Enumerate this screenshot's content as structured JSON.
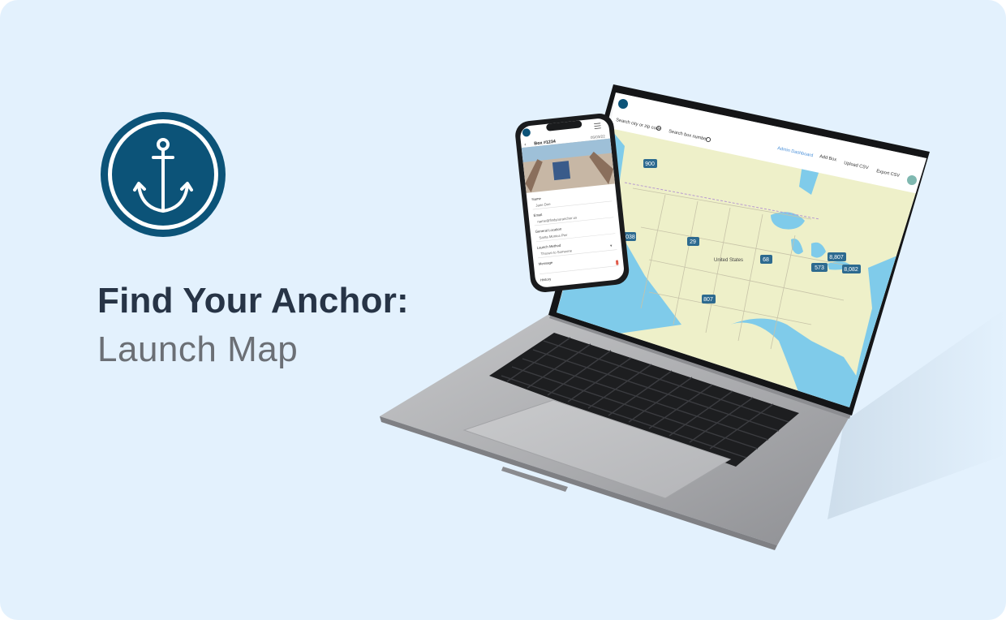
{
  "hero": {
    "title": "Find Your Anchor:",
    "subtitle": "Launch Map",
    "logo_icon": "anchor-icon",
    "brand_color": "#0c5378",
    "background": "#e3f1fd"
  },
  "laptop_app": {
    "search_city_placeholder": "Search city or zip code",
    "search_box_placeholder": "Search box number",
    "nav": {
      "admin": "Admin Dashboard",
      "add": "Add Box",
      "upload": "Upload CSV",
      "export": "Export CSV"
    },
    "map": {
      "country_label": "United States",
      "clusters": [
        "900",
        "1,038",
        "29",
        "68",
        "8,807",
        "573",
        "8,082",
        "807"
      ]
    }
  },
  "phone_app": {
    "box_title": "Box #1234",
    "date": "05/03/22",
    "fields": {
      "name_label": "Name",
      "name_value": "Jane Doe",
      "email_label": "Email",
      "email_value": "name@findyouranchor.us",
      "location_label": "General Location",
      "location_value": "Santa Monica Pier",
      "method_label": "Launch Method",
      "method_value": "Thrown to Someone",
      "message_label": "Message",
      "history_label": "History"
    }
  }
}
